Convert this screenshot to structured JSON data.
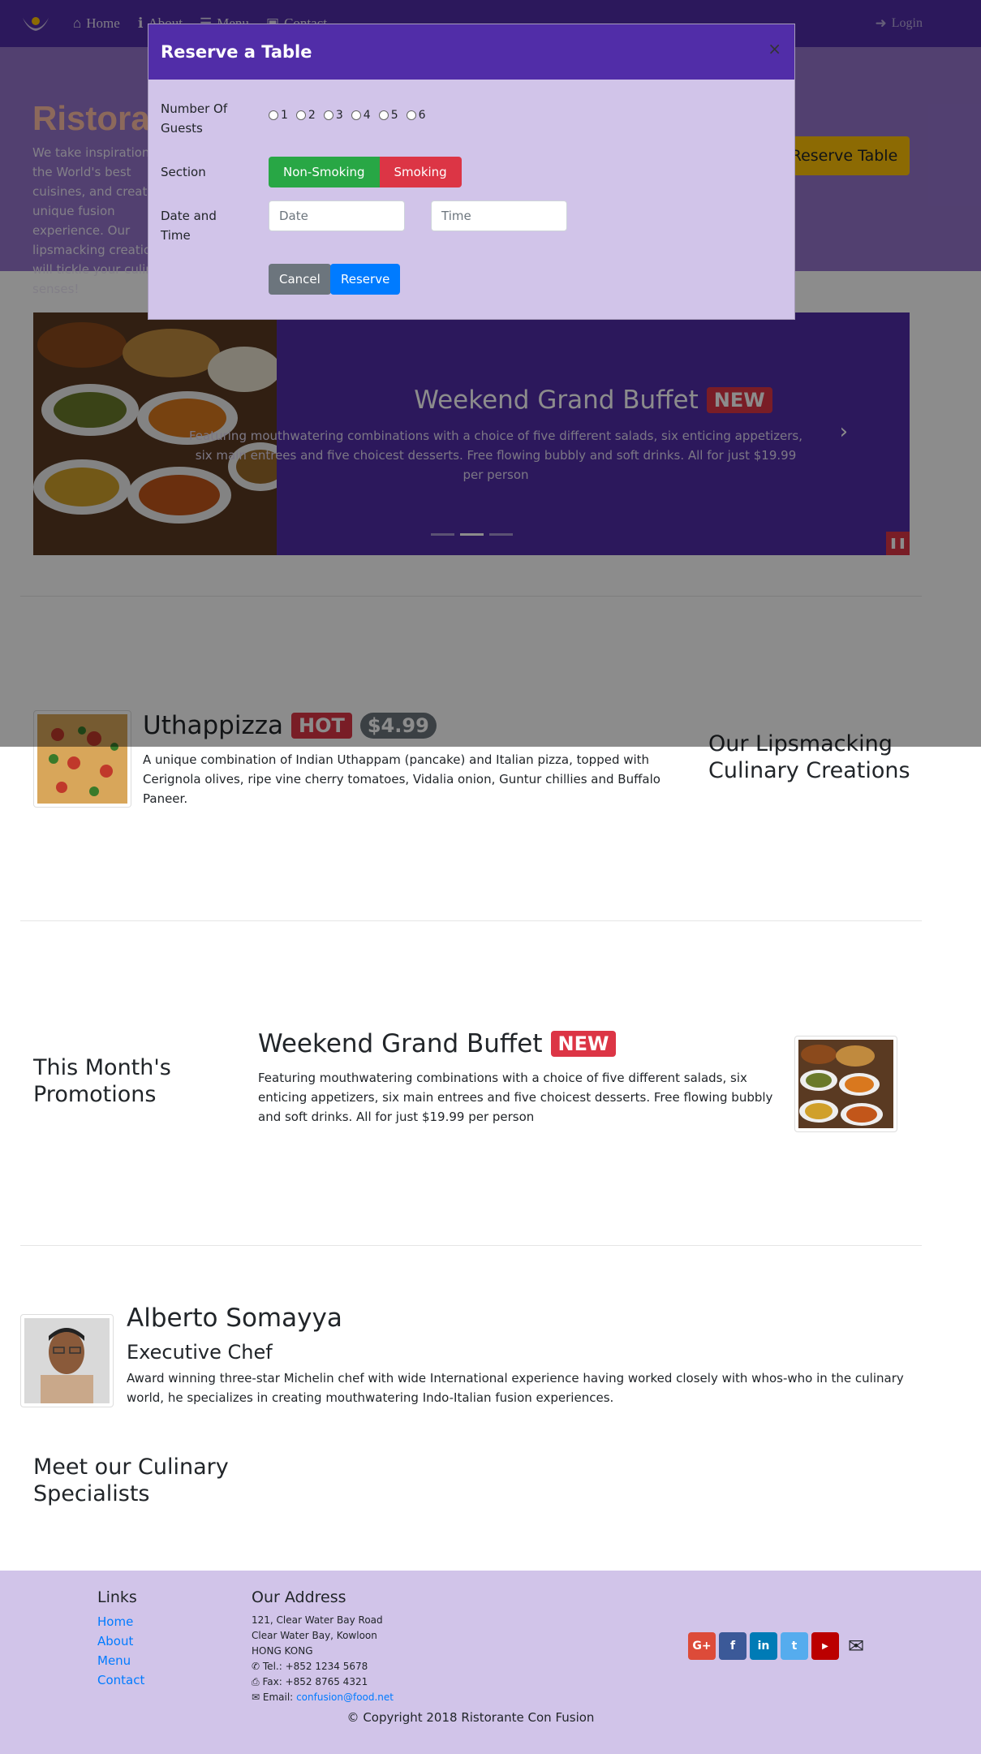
{
  "navbar": {
    "home": "Home",
    "about": "About",
    "menu": "Menu",
    "contact": "Contact",
    "login": "Login"
  },
  "jumbotron": {
    "title": "Ristorante con Fusion",
    "text": "We take inspiration from the World's best cuisines, and create a unique fusion experience. Our lipsmacking creations will tickle your culinary senses!",
    "reserve_label": "Reserve Table"
  },
  "carousel": {
    "title": "Weekend Grand Buffet",
    "badge": "NEW",
    "text": "Featuring mouthwatering combinations with a choice of five different salads, six enticing appetizers, six main entrees and five choicest desserts. Free flowing bubbly and soft drinks. All for just $19.99 per person",
    "active_slide_index": 1,
    "slide_count": 3
  },
  "dish": {
    "name": "Uthappizza",
    "badge": "HOT",
    "price": "$4.99",
    "description": "A unique combination of Indian Uthappam (pancake) and Italian pizza, topped with Cerignola olives, ripe vine cherry tomatoes, Vidalia onion, Guntur chillies and Buffalo Paneer.",
    "side_heading": "Our Lipsmacking Culinary Creations"
  },
  "promotion": {
    "side_heading": "This Month's Promotions",
    "name": "Weekend Grand Buffet",
    "badge": "NEW",
    "description": "Featuring mouthwatering combinations with a choice of five different salads, six enticing appetizers, six main entrees and five choicest desserts. Free flowing bubbly and soft drinks. All for just $19.99 per person"
  },
  "leader": {
    "name": "Alberto Somayya",
    "designation": "Executive Chef",
    "description": "Award winning three-star Michelin chef with wide International experience having worked closely with whos-who in the culinary world, he specializes in creating mouthwatering Indo-Italian fusion experiences.",
    "side_heading": "Meet our Culinary Specialists"
  },
  "modal": {
    "title": "Reserve a Table",
    "close": "×",
    "guests_label": "Number Of Guests",
    "guest_options": [
      "1",
      "2",
      "3",
      "4",
      "5",
      "6"
    ],
    "section_label": "Section",
    "non_smoking": "Non-Smoking",
    "smoking": "Smoking",
    "datetime_label": "Date and Time",
    "date_placeholder": "Date",
    "time_placeholder": "Time",
    "cancel": "Cancel",
    "reserve": "Reserve"
  },
  "footer": {
    "links_heading": "Links",
    "links": [
      "Home",
      "About",
      "Menu",
      "Contact"
    ],
    "address_heading": "Our Address",
    "address_lines": [
      "121, Clear Water Bay Road",
      "Clear Water Bay, Kowloon",
      "HONG KONG"
    ],
    "tel": "Tel.: +852 1234 5678",
    "fax": "Fax: +852 8765 4321",
    "email_label": "Email:",
    "email": "confusion@food.net",
    "copyright": "© Copyright 2018 Ristorante Con Fusion",
    "social_colors": {
      "google": "#dd4b39",
      "facebook": "#3b5998",
      "linkedin": "#007bb6",
      "twitter": "#55acee",
      "youtube": "#bb0000"
    }
  },
  "colors": {
    "primary": "#512DA8",
    "light": "#D1C4E9",
    "mid": "#9575CD"
  }
}
